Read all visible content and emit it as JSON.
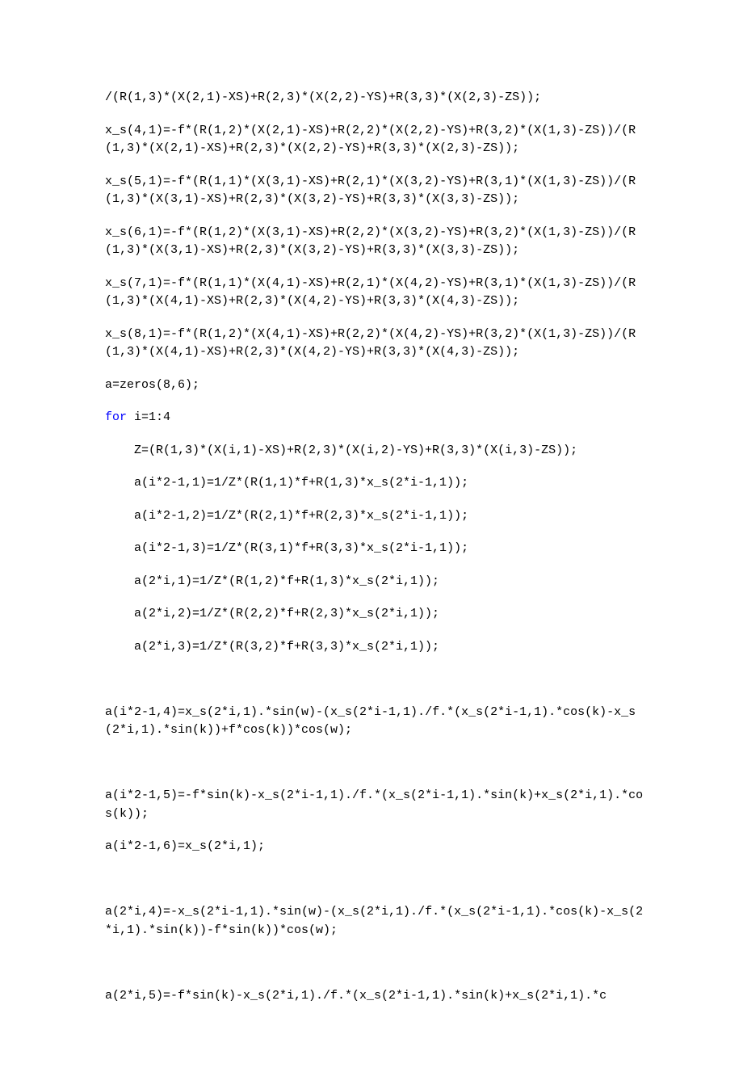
{
  "lines": [
    {
      "cls": "code-line",
      "html": "/(R(1,3)*(X(2,1)-XS)+R(2,3)*(X(2,2)-YS)+R(3,3)*(X(2,3)-ZS));"
    },
    {
      "cls": "code-line",
      "html": "x_s(4,1)=-f*(R(1,2)*(X(2,1)-XS)+R(2,2)*(X(2,2)-YS)+R(3,2)*(X(1,3)-ZS))/(R(1,3)*(X(2,1)-XS)+R(2,3)*(X(2,2)-YS)+R(3,3)*(X(2,3)-ZS));"
    },
    {
      "cls": "code-line",
      "html": "x_s(5,1)=-f*(R(1,1)*(X(3,1)-XS)+R(2,1)*(X(3,2)-YS)+R(3,1)*(X(1,3)-ZS))/(R(1,3)*(X(3,1)-XS)+R(2,3)*(X(3,2)-YS)+R(3,3)*(X(3,3)-ZS));"
    },
    {
      "cls": "code-line",
      "html": "x_s(6,1)=-f*(R(1,2)*(X(3,1)-XS)+R(2,2)*(X(3,2)-YS)+R(3,2)*(X(1,3)-ZS))/(R(1,3)*(X(3,1)-XS)+R(2,3)*(X(3,2)-YS)+R(3,3)*(X(3,3)-ZS));"
    },
    {
      "cls": "code-line",
      "html": "x_s(7,1)=-f*(R(1,1)*(X(4,1)-XS)+R(2,1)*(X(4,2)-YS)+R(3,1)*(X(1,3)-ZS))/(R(1,3)*(X(4,1)-XS)+R(2,3)*(X(4,2)-YS)+R(3,3)*(X(4,3)-ZS));"
    },
    {
      "cls": "code-line",
      "html": "x_s(8,1)=-f*(R(1,2)*(X(4,1)-XS)+R(2,2)*(X(4,2)-YS)+R(3,2)*(X(1,3)-ZS))/(R(1,3)*(X(4,1)-XS)+R(2,3)*(X(4,2)-YS)+R(3,3)*(X(4,3)-ZS));"
    },
    {
      "cls": "code-line",
      "html": "a=zeros(8,6);"
    },
    {
      "cls": "code-line",
      "html": "<span class=\"kw\">for</span> i=1:4"
    },
    {
      "cls": "code-line indent",
      "html": "Z=(R(1,3)*(X(i,1)-XS)+R(2,3)*(X(i,2)-YS)+R(3,3)*(X(i,3)-ZS));"
    },
    {
      "cls": "code-line indent",
      "html": "a(i*2-1,1)=1/Z*(R(1,1)*f+R(1,3)*x_s(2*i-1,1));"
    },
    {
      "cls": "code-line indent",
      "html": "a(i*2-1,2)=1/Z*(R(2,1)*f+R(2,3)*x_s(2*i-1,1));"
    },
    {
      "cls": "code-line indent",
      "html": "a(i*2-1,3)=1/Z*(R(3,1)*f+R(3,3)*x_s(2*i-1,1));"
    },
    {
      "cls": "code-line indent",
      "html": "a(2*i,1)=1/Z*(R(1,2)*f+R(1,3)*x_s(2*i,1));"
    },
    {
      "cls": "code-line indent",
      "html": "a(2*i,2)=1/Z*(R(2,2)*f+R(2,3)*x_s(2*i,1));"
    },
    {
      "cls": "code-line indent",
      "html": "a(2*i,3)=1/Z*(R(3,2)*f+R(3,3)*x_s(2*i,1));"
    },
    {
      "cls": "code-line",
      "html": "&nbsp;"
    },
    {
      "cls": "code-line",
      "html": "a(i*2-1,4)=x_s(2*i,1).*sin(w)-(x_s(2*i-1,1)./f.*(x_s(2*i-1,1).*cos(k)-x_s(2*i,1).*sin(k))+f*cos(k))*cos(w);"
    },
    {
      "cls": "code-line",
      "html": "&nbsp;"
    },
    {
      "cls": "code-line",
      "html": "a(i*2-1,5)=-f*sin(k)-x_s(2*i-1,1)./f.*(x_s(2*i-1,1).*sin(k)+x_s(2*i,1).*cos(k));"
    },
    {
      "cls": "code-line",
      "html": "a(i*2-1,6)=x_s(2*i,1);"
    },
    {
      "cls": "code-line",
      "html": "&nbsp;"
    },
    {
      "cls": "code-line",
      "html": "a(2*i,4)=-x_s(2*i-1,1).*sin(w)-(x_s(2*i,1)./f.*(x_s(2*i-1,1).*cos(k)-x_s(2*i,1).*sin(k))-f*sin(k))*cos(w);"
    },
    {
      "cls": "code-line",
      "html": "&nbsp;"
    },
    {
      "cls": "code-line",
      "html": "a(2*i,5)=-f*sin(k)-x_s(2*i,1)./f.*(x_s(2*i-1,1).*sin(k)+x_s(2*i,1).*c"
    }
  ]
}
